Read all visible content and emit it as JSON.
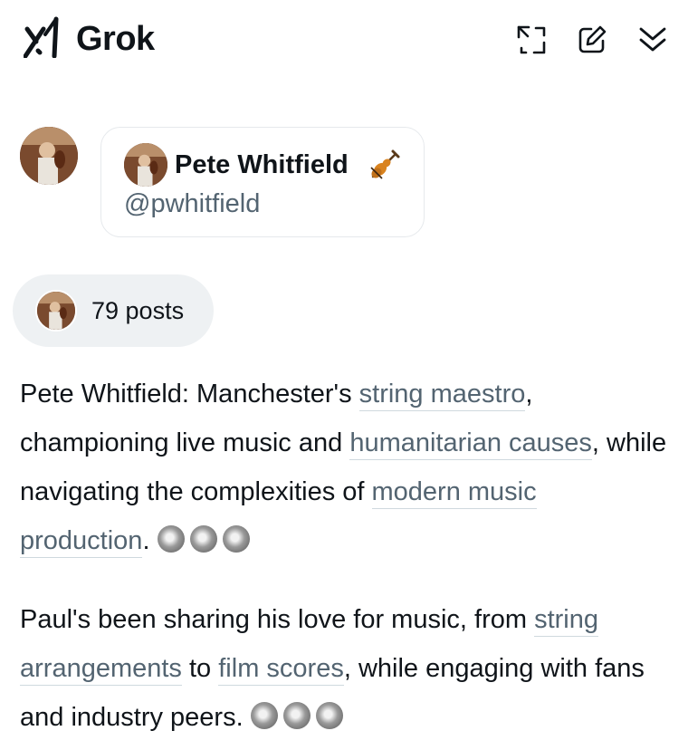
{
  "header": {
    "title": "Grok",
    "icons": [
      "grok-logo-icon",
      "expand-icon",
      "edit-icon",
      "collapse-icon"
    ]
  },
  "profile": {
    "name": "Pete Whitfield",
    "emoji": "violin-icon",
    "handle": "@pwhitfield"
  },
  "posts_pill": {
    "label": "79 posts"
  },
  "paragraph1": {
    "t1": "Pete Whitfield: Manchester's ",
    "l1": "string maestro",
    "t2": ", championing live music and ",
    "l2": "humanitarian causes",
    "t3": ", while navigating the complexities of ",
    "l3": "modern music production",
    "t4": "."
  },
  "paragraph2": {
    "t1": "Paul's been sharing his love for music, from ",
    "l1": "string arrangements",
    "t2": " to ",
    "l2": "film scores",
    "t3": ", while engaging with fans and industry peers."
  },
  "colors": {
    "text": "#0f1419",
    "secondary": "#536471",
    "pill_bg": "#eef1f3",
    "card_border": "#e6e9ec"
  }
}
